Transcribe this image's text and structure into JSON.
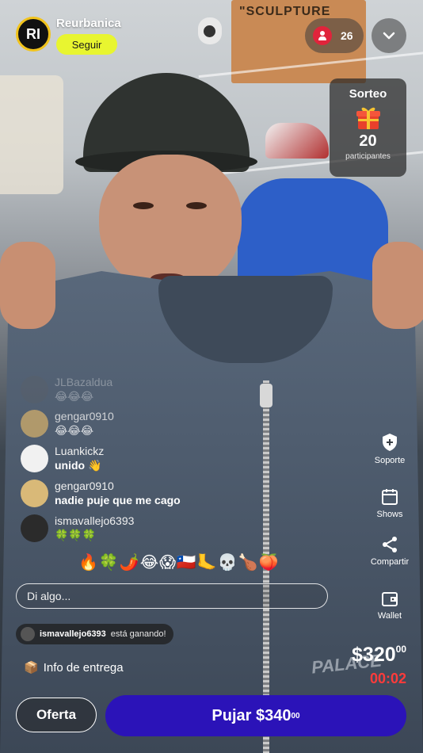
{
  "header": {
    "seller_name": "Reurbanica",
    "seller_avatar_text": "RI",
    "follow_label": "Seguir",
    "viewer_count": "26"
  },
  "scene": {
    "box_text": "\"SCULPTURE",
    "garment_brand_text": "PALACE"
  },
  "giveaway": {
    "title": "Sorteo",
    "icon": "gift-icon",
    "count": "20",
    "label": "participantes"
  },
  "chat": {
    "messages": [
      {
        "user": "JLBazaldua",
        "text": "😂😂😂",
        "faded": true
      },
      {
        "user": "gengar0910",
        "text": "😂😂😂"
      },
      {
        "user": "Luankickz",
        "text": "unido 👋"
      },
      {
        "user": "gengar0910",
        "text": "nadie puje que me cago"
      },
      {
        "user": "ismavallejo6393",
        "text": "🍀🍀🍀"
      }
    ],
    "reactions": "🔥🍀🌶️😂😱🇨🇱🦶💀🍗🍑",
    "input_placeholder": "Di algo..."
  },
  "side_actions": [
    {
      "label": "Soporte",
      "icon": "support-shield-icon"
    },
    {
      "label": "Shows",
      "icon": "calendar-icon"
    },
    {
      "label": "Compartir",
      "icon": "share-icon"
    },
    {
      "label": "Wallet",
      "icon": "wallet-icon"
    }
  ],
  "auction": {
    "winner_user": "ismavallejo6393",
    "winner_text": "está ganando!",
    "delivery_emoji": "📦",
    "delivery_label": "Info de entrega",
    "price_main": "$320",
    "price_cents": "00",
    "timer": "00:02",
    "offer_label": "Oferta",
    "bid_label_main": "Pujar $340",
    "bid_label_cents": "00"
  },
  "colors": {
    "follow_button": "#e8f530",
    "bid_button": "#2b13b8",
    "timer": "#ff3b3b",
    "viewer_badge": "#e0243b"
  }
}
